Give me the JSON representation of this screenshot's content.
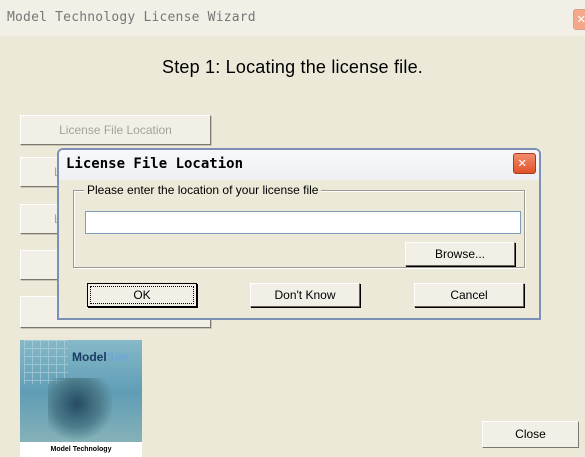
{
  "window": {
    "title": "Model Technology License Wizard"
  },
  "step_title": "Step 1: Locating the license file.",
  "wizard_buttons": [
    {
      "label": "License File Location"
    },
    {
      "label": "L"
    },
    {
      "label": "L"
    },
    {
      "label": ""
    },
    {
      "label": ""
    }
  ],
  "logo": {
    "brand_main": "Model",
    "brand_accent": "Sim",
    "bottom_text": "Model Technology"
  },
  "close_button": "Close",
  "dialog": {
    "title": "License File Location",
    "group_label": "Please enter the location of your license file",
    "input_value": "",
    "input_placeholder": "",
    "browse_label": "Browse...",
    "ok_label": "OK",
    "dont_know_label": "Don't Know",
    "cancel_label": "Cancel"
  },
  "colors": {
    "window_bg": "#ece9d8",
    "dialog_border": "#7d8fb7",
    "close_red": "#e15329",
    "input_border": "#7f9db9"
  }
}
